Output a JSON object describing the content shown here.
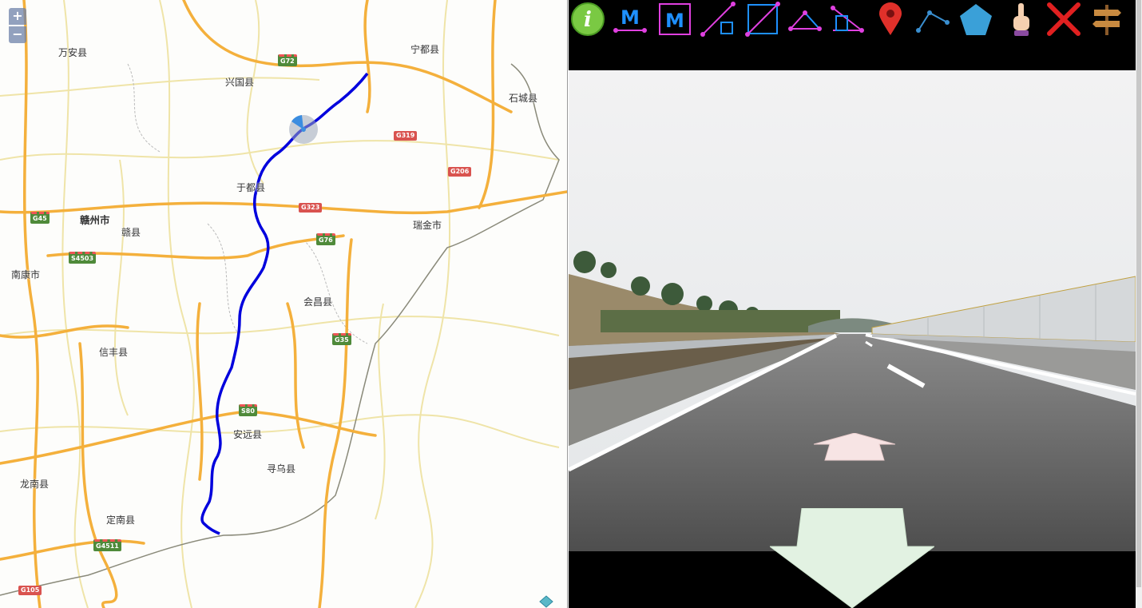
{
  "map": {
    "zoom_in_label": "+",
    "zoom_out_label": "−",
    "places": [
      {
        "name": "万安县",
        "type": "county"
      },
      {
        "name": "兴国县",
        "type": "county"
      },
      {
        "name": "宁都县",
        "type": "county"
      },
      {
        "name": "石城县",
        "type": "county"
      },
      {
        "name": "于都县",
        "type": "county"
      },
      {
        "name": "赣州市",
        "type": "city"
      },
      {
        "name": "赣县",
        "type": "county"
      },
      {
        "name": "瑞金市",
        "type": "county"
      },
      {
        "name": "南康市",
        "type": "county"
      },
      {
        "name": "会昌县",
        "type": "county"
      },
      {
        "name": "信丰县",
        "type": "county"
      },
      {
        "name": "安远县",
        "type": "county"
      },
      {
        "name": "寻乌县",
        "type": "county"
      },
      {
        "name": "龙南县",
        "type": "county"
      },
      {
        "name": "定南县",
        "type": "county"
      }
    ],
    "road_shields": [
      {
        "label": "G72",
        "kind": "expressway"
      },
      {
        "label": "G319",
        "kind": "national"
      },
      {
        "label": "G206",
        "kind": "national"
      },
      {
        "label": "G323",
        "kind": "national"
      },
      {
        "label": "G45",
        "kind": "expressway"
      },
      {
        "label": "G76",
        "kind": "expressway"
      },
      {
        "label": "S4503",
        "kind": "expressway"
      },
      {
        "label": "G35",
        "kind": "expressway"
      },
      {
        "label": "S80",
        "kind": "expressway"
      },
      {
        "label": "G4511",
        "kind": "expressway"
      },
      {
        "label": "G105",
        "kind": "national"
      }
    ],
    "route_color": "#0000dd",
    "layer_icon": "layers-icon"
  },
  "toolbar": {
    "tools": [
      {
        "name": "info-icon"
      },
      {
        "name": "measure-distance-icon",
        "glyph": "M"
      },
      {
        "name": "measure-height-icon",
        "glyph": "M"
      },
      {
        "name": "slope-up-icon"
      },
      {
        "name": "slope-box-icon"
      },
      {
        "name": "angle-measure-icon"
      },
      {
        "name": "angle-box-icon"
      },
      {
        "name": "map-pin-icon"
      },
      {
        "name": "polyline-icon"
      },
      {
        "name": "polygon-icon"
      },
      {
        "name": "pointer-hand-icon"
      },
      {
        "name": "close-x-icon"
      },
      {
        "name": "signpost-icon"
      }
    ]
  },
  "viewer": {
    "forward_arrow": "forward-arrow-icon",
    "back_arrow": "back-arrow-icon"
  }
}
